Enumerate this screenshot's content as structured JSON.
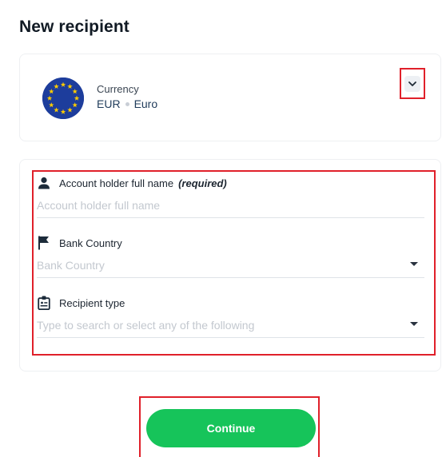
{
  "header": {
    "title": "New recipient"
  },
  "currency": {
    "label": "Currency",
    "code": "EUR",
    "name": "Euro",
    "flag_icon": "eu-flag-icon",
    "toggle_icon": "chevron-down-icon"
  },
  "form": {
    "fields": [
      {
        "label": "Account holder full name",
        "required_label": "(required)",
        "placeholder": "Account holder full name",
        "icon": "user-icon"
      },
      {
        "label": "Bank Country",
        "placeholder": "Bank Country",
        "icon": "flag-icon"
      },
      {
        "label": "Recipient type",
        "placeholder": "Type to search or select any of the following",
        "icon": "id-badge-icon"
      }
    ]
  },
  "actions": {
    "continue_label": "Continue"
  },
  "colors": {
    "accent": "#16c45a",
    "highlight": "#e0202a",
    "flag_blue": "#1d3d9c",
    "flag_star": "#ffcc00"
  }
}
